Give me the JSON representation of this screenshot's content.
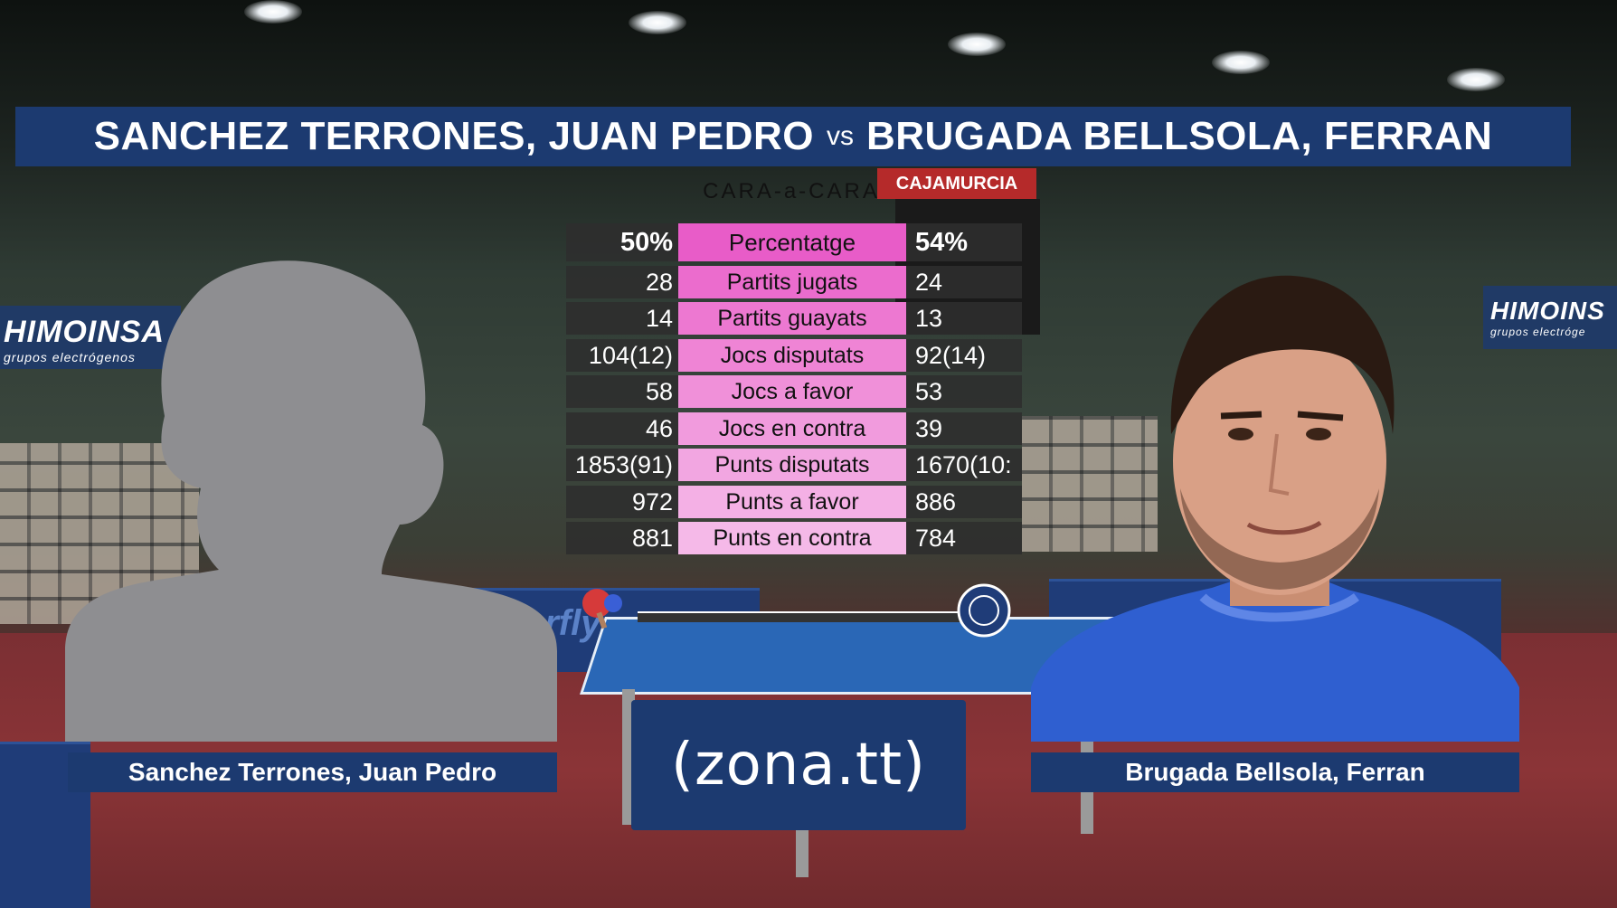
{
  "header": {
    "player_left": "SANCHEZ TERRONES, JUAN PEDRO",
    "vs": "vs",
    "player_right": "BRUGADA BELLSOLA, FERRAN"
  },
  "subtitle": "CARA-a-CARA",
  "stats": [
    {
      "left": "50%",
      "label": "Percentatge",
      "right": "54%",
      "color": "#e85cc8"
    },
    {
      "left": "28",
      "label": "Partits jugats",
      "right": "24",
      "color": "#eb6ccd"
    },
    {
      "left": "14",
      "label": "Partits guayats",
      "right": "13",
      "color": "#ed78d1"
    },
    {
      "left": "104(12)",
      "label": "Jocs disputats",
      "right": "92(14)",
      "color": "#ef84d5"
    },
    {
      "left": "58",
      "label": "Jocs a favor",
      "right": "53",
      "color": "#f090d9"
    },
    {
      "left": "46",
      "label": "Jocs en contra",
      "right": "39",
      "color": "#f19bdd"
    },
    {
      "left": "1853(91)",
      "label": "Punts disputats",
      "right": "1670(10:",
      "color": "#f2a6e1"
    },
    {
      "left": "972",
      "label": "Punts a favor",
      "right": "886",
      "color": "#f4b0e5"
    },
    {
      "left": "881",
      "label": "Punts en contra",
      "right": "784",
      "color": "#f5b9e8"
    }
  ],
  "name_left": "Sanchez Terrones, Juan Pedro",
  "name_right": "Brugada Bellsola, Ferran",
  "logo": "(zona.tt)",
  "background_signs": {
    "himoinsa_left": "HIMOINSA",
    "himoinsa_left_sub": "grupos electrógenos",
    "himoinsa_right": "HIMOINS",
    "himoinsa_right_sub": "grupos electróge",
    "cajamurcia": "CAJAMURCIA",
    "butterfly": "Butterfly"
  },
  "colors": {
    "banner_blue": "#1c3a70",
    "stat_dark": "#2d2d2d",
    "stat_pink": "#e85cc8",
    "jersey_blue": "#2f5fd0"
  }
}
